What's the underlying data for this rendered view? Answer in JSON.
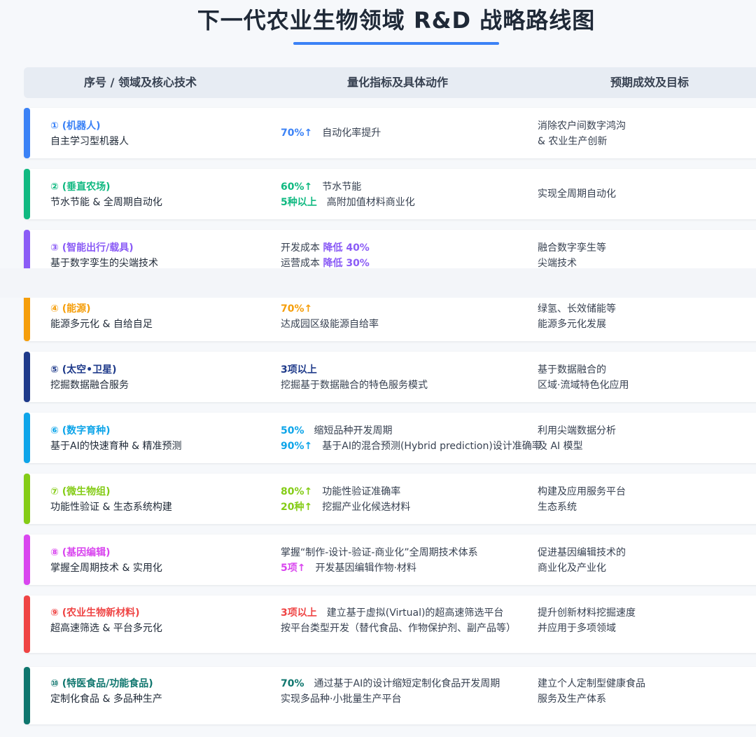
{
  "page": {
    "title": "下一代农业生物领域 R&D 战略路线图"
  },
  "table": {
    "headers": [
      "序号 / 领域及核心技术",
      "量化指标及具体动作",
      "预期成效及目标"
    ],
    "rows": [
      {
        "name": "① (机器人)",
        "sub": "自主学习型机器人",
        "color": "#3b82f6",
        "metric_1_value": "70%↑",
        "metric_1_text": "自动化率提升",
        "outcome_1": "消除农户间数字鸿沟",
        "outcome_2": "& 农业生产创新"
      },
      {
        "name": "② (垂直农场)",
        "sub": "节水节能 & 全周期自动化",
        "color": "#10b981",
        "metric_1_value": "60%↑",
        "metric_1_text": "节水节能",
        "metric_2_value": "5种以上",
        "metric_2_text": "高附加值材料商业化",
        "outcome_1": "实现全周期自动化"
      },
      {
        "name": "③ (智能出行/载具)",
        "sub": "基于数字孪生的尖端技术",
        "color": "#8b5cf6",
        "metric_1_prefix": "开发成本",
        "metric_1_value": "降低 40%",
        "metric_2_prefix": "运营成本",
        "metric_2_value": "降低 30%",
        "outcome_1": "融合数字孪生等",
        "outcome_2": "尖端技术"
      },
      {
        "name": "④ (能源)",
        "sub": "能源多元化 & 自给自足",
        "color": "#f59e0b",
        "metric_1_value": "70%↑",
        "metric_2_text": "达成园区级能源自给率",
        "outcome_1": "绿氢、长效储能等",
        "outcome_2": "能源多元化发展"
      },
      {
        "name": "⑤ (太空•卫星)",
        "sub": "挖掘数据融合服务",
        "color": "#1e3a8a",
        "metric_1_value": "3项以上",
        "metric_2_text": "挖掘基于数据融合的特色服务模式",
        "outcome_1": "基于数据融合的",
        "outcome_2": "区域·流域特色化应用"
      },
      {
        "name": "⑥ (数字育种)",
        "sub": "基于AI的快速育种 & 精准预测",
        "color": "#0ea5e9",
        "metric_1_value": "50%",
        "metric_1_text": "缩短品种开发周期",
        "metric_2_value": "90%↑",
        "metric_2_text": "基于AI的混合预测(Hybrid prediction)设计准确率",
        "outcome_1": "利用尖端数据分析",
        "outcome_2": "及 AI 模型"
      },
      {
        "name": "⑦ (微生物组)",
        "sub": "功能性验证 & 生态系统构建",
        "color": "#84cc16",
        "metric_1_value": "80%↑",
        "metric_1_text": "功能性验证准确率",
        "metric_2_value": "20种↑",
        "metric_2_text": "挖掘产业化候选材料",
        "outcome_1": "构建及应用服务平台",
        "outcome_2": "生态系统"
      },
      {
        "name": "⑧ (基因编辑)",
        "sub": "掌握全周期技术 & 实用化",
        "color": "#d946ef",
        "metric_1_text": "掌握“制作-设计-验证-商业化”全周期技术体系",
        "metric_2_value": "5项↑",
        "metric_2_text": "开发基因编辑作物·材料",
        "outcome_1": "促进基因编辑技术的",
        "outcome_2": "商业化及产业化"
      },
      {
        "name": "⑨ (农业生物新材料)",
        "sub": "超高速筛选 & 平台多元化",
        "color": "#ef4444",
        "metric_1_value": "3项以上",
        "metric_1_text": "建立基于虚拟(Virtual)的超高速筛选平台",
        "metric_2_text": "按平台类型开发（替代食品、作物保护剂、副产品等）",
        "outcome_1": "提升创新材料挖掘速度",
        "outcome_2": "并应用于多项领域"
      },
      {
        "name": "⑩ (特医食品/功能食品)",
        "sub": "定制化食品 & 多品种生产",
        "color": "#0f766e",
        "metric_1_value": "70%",
        "metric_1_text": "通过基于AI的设计缩短定制化食品开发周期",
        "metric_2_text": "实现多品种·小批量生产平台",
        "outcome_1": "建立个人定制型健康食品",
        "outcome_2": "服务及生产体系"
      }
    ]
  }
}
